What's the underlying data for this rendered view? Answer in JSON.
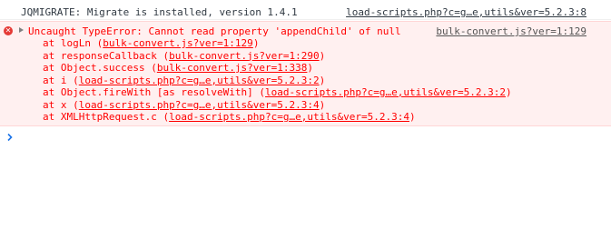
{
  "log_message": {
    "text": "JQMIGRATE: Migrate is installed, version 1.4.1",
    "source": "load-scripts.php?c=g…e,utils&ver=5.2.3:8"
  },
  "error_message": {
    "icon": "error-x-icon",
    "text": "Uncaught TypeError: Cannot read property 'appendChild' of null",
    "source": "bulk-convert.js?ver=1:129",
    "frames": [
      {
        "prefix": "at logLn (",
        "link": "bulk-convert.js?ver=1:129",
        "suffix": ")"
      },
      {
        "prefix": "at responseCallback (",
        "link": "bulk-convert.js?ver=1:290",
        "suffix": ")"
      },
      {
        "prefix": "at Object.success (",
        "link": "bulk-convert.js?ver=1:338",
        "suffix": ")"
      },
      {
        "prefix": "at i (",
        "link": "load-scripts.php?c=g…e,utils&ver=5.2.3:2",
        "suffix": ")"
      },
      {
        "prefix": "at Object.fireWith [as resolveWith] (",
        "link": "load-scripts.php?c=g…e,utils&ver=5.2.3:2",
        "suffix": ")"
      },
      {
        "prefix": "at x (",
        "link": "load-scripts.php?c=g…e,utils&ver=5.2.3:4",
        "suffix": ")"
      },
      {
        "prefix": "at XMLHttpRequest.c (",
        "link": "load-scripts.php?c=g…e,utils&ver=5.2.3:4",
        "suffix": ")"
      }
    ]
  },
  "prompt": {
    "icon": "chevron-right-icon"
  },
  "colors": {
    "error": "#ff0000",
    "error_bg": "#fff0f0",
    "prompt": "#1a73e8"
  }
}
